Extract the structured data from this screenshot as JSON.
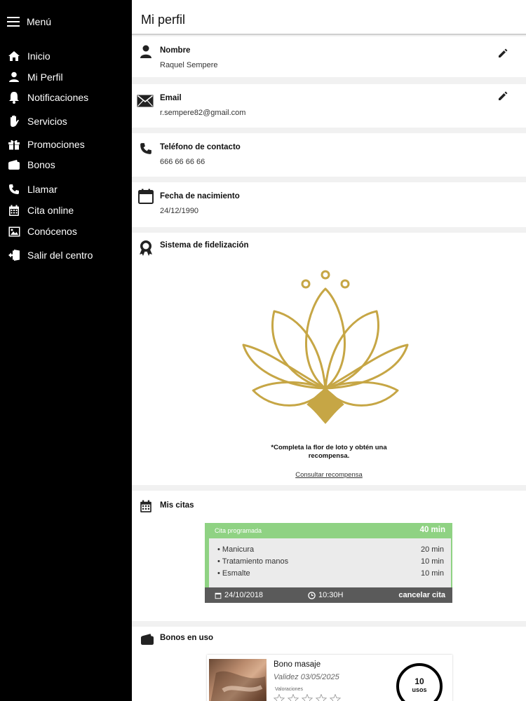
{
  "sidebar": {
    "menu_label": "Menú",
    "items": [
      {
        "label": "Inicio"
      },
      {
        "label": "Mi Perfil"
      },
      {
        "label": "Notificaciones"
      },
      {
        "label": "Servicios"
      },
      {
        "label": "Promociones"
      },
      {
        "label": "Bonos"
      },
      {
        "label": "Llamar"
      },
      {
        "label": "Cita online"
      },
      {
        "label": "Conócenos"
      },
      {
        "label": "Salir del centro"
      }
    ]
  },
  "header": {
    "title": "Mi perfil"
  },
  "profile": {
    "name": {
      "label": "Nombre",
      "value": "Raquel Sempere"
    },
    "email": {
      "label": "Email",
      "value": "r.sempere82@gmail.com"
    },
    "phone": {
      "label": "Teléfono de contacto",
      "value": "666 66 66 66"
    },
    "birth": {
      "label": "Fecha de nacimiento",
      "value": "24/12/1990"
    }
  },
  "loyalty": {
    "label": "Sistema de fidelización",
    "note_line1": "*Completa la flor de loto y obtén una",
    "note_line2": "recompensa.",
    "link": "Consultar recompensa",
    "petals_completed": 1,
    "colors": {
      "gold": "#c6a645"
    }
  },
  "citas": {
    "label": "Mis citas",
    "appointment": {
      "status": "Cita programada",
      "total": "40 min",
      "services": [
        {
          "name": "Manicura",
          "duration": "20 min"
        },
        {
          "name": "Tratamiento manos",
          "duration": "10 min"
        },
        {
          "name": "Esmalte",
          "duration": "10 min"
        }
      ],
      "date": "24/10/2018",
      "time": "10:30H",
      "cancel": "cancelar cita"
    },
    "colors": {
      "accent": "#8fd283",
      "footer": "#5a5a5a"
    }
  },
  "bonos": {
    "label": "Bonos en uso",
    "item": {
      "title": "Bono masaje",
      "validity": "Validez  03/05/2025",
      "ratings_label": "Valoraciones",
      "rating": 0,
      "uses_count": "10",
      "uses_label": "usos"
    }
  }
}
